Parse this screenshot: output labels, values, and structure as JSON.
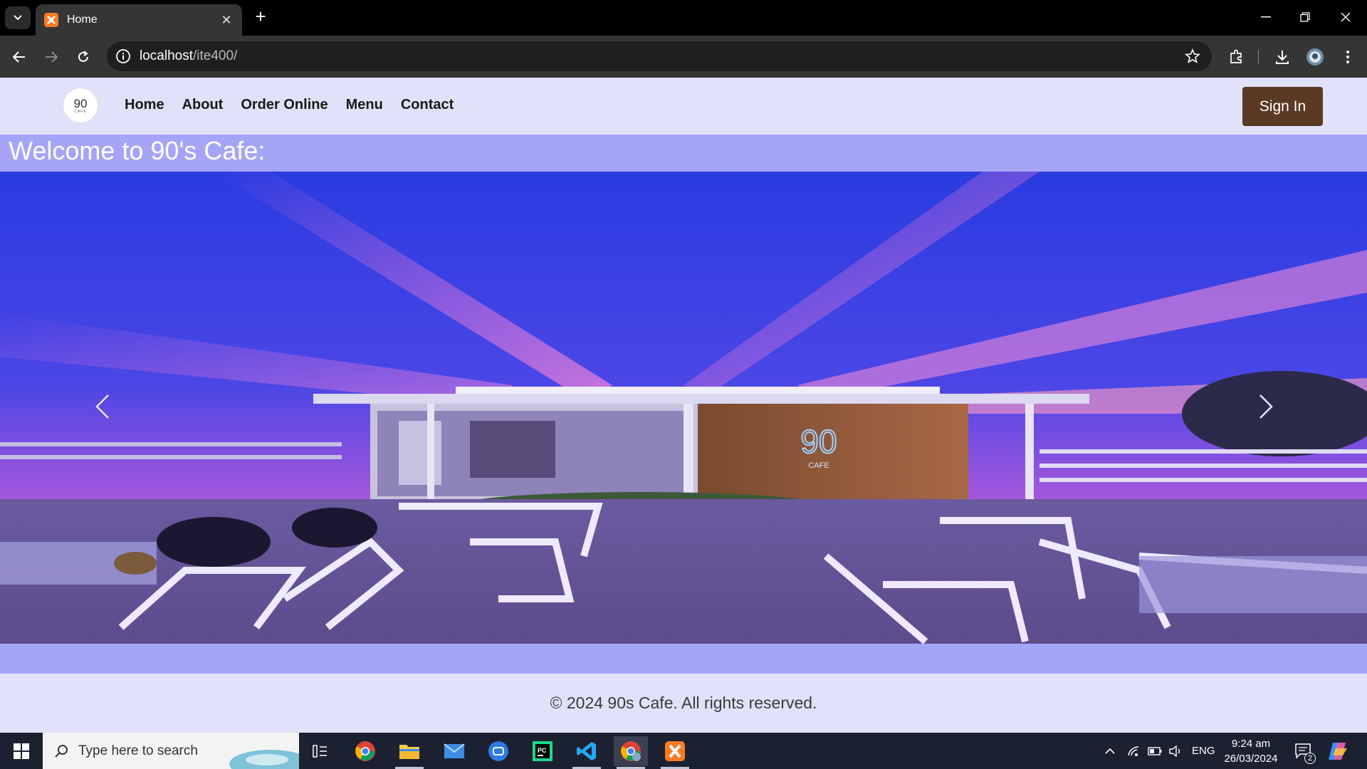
{
  "browser": {
    "tab_title": "Home",
    "url_host": "localhost",
    "url_path": "/ite400/"
  },
  "site": {
    "logo_text": "90",
    "logo_sub": "CAFE",
    "nav": [
      "Home",
      "About",
      "Order Online",
      "Menu",
      "Contact"
    ],
    "signin_label": "Sign In",
    "welcome": "Welcome to 90's Cafe:",
    "hero_sign_text": "90",
    "hero_sign_sub": "CAFE",
    "footer": "© 2024 90s Cafe. All rights reserved."
  },
  "taskbar": {
    "search_placeholder": "Type here to search",
    "lang": "ENG",
    "time": "9:24 am",
    "date": "26/03/2024",
    "notif_count": "2"
  },
  "colors": {
    "nav_bg": "#e1e1fa",
    "page_bg": "#a5a5f7",
    "signin_bg": "#5a3a22"
  }
}
